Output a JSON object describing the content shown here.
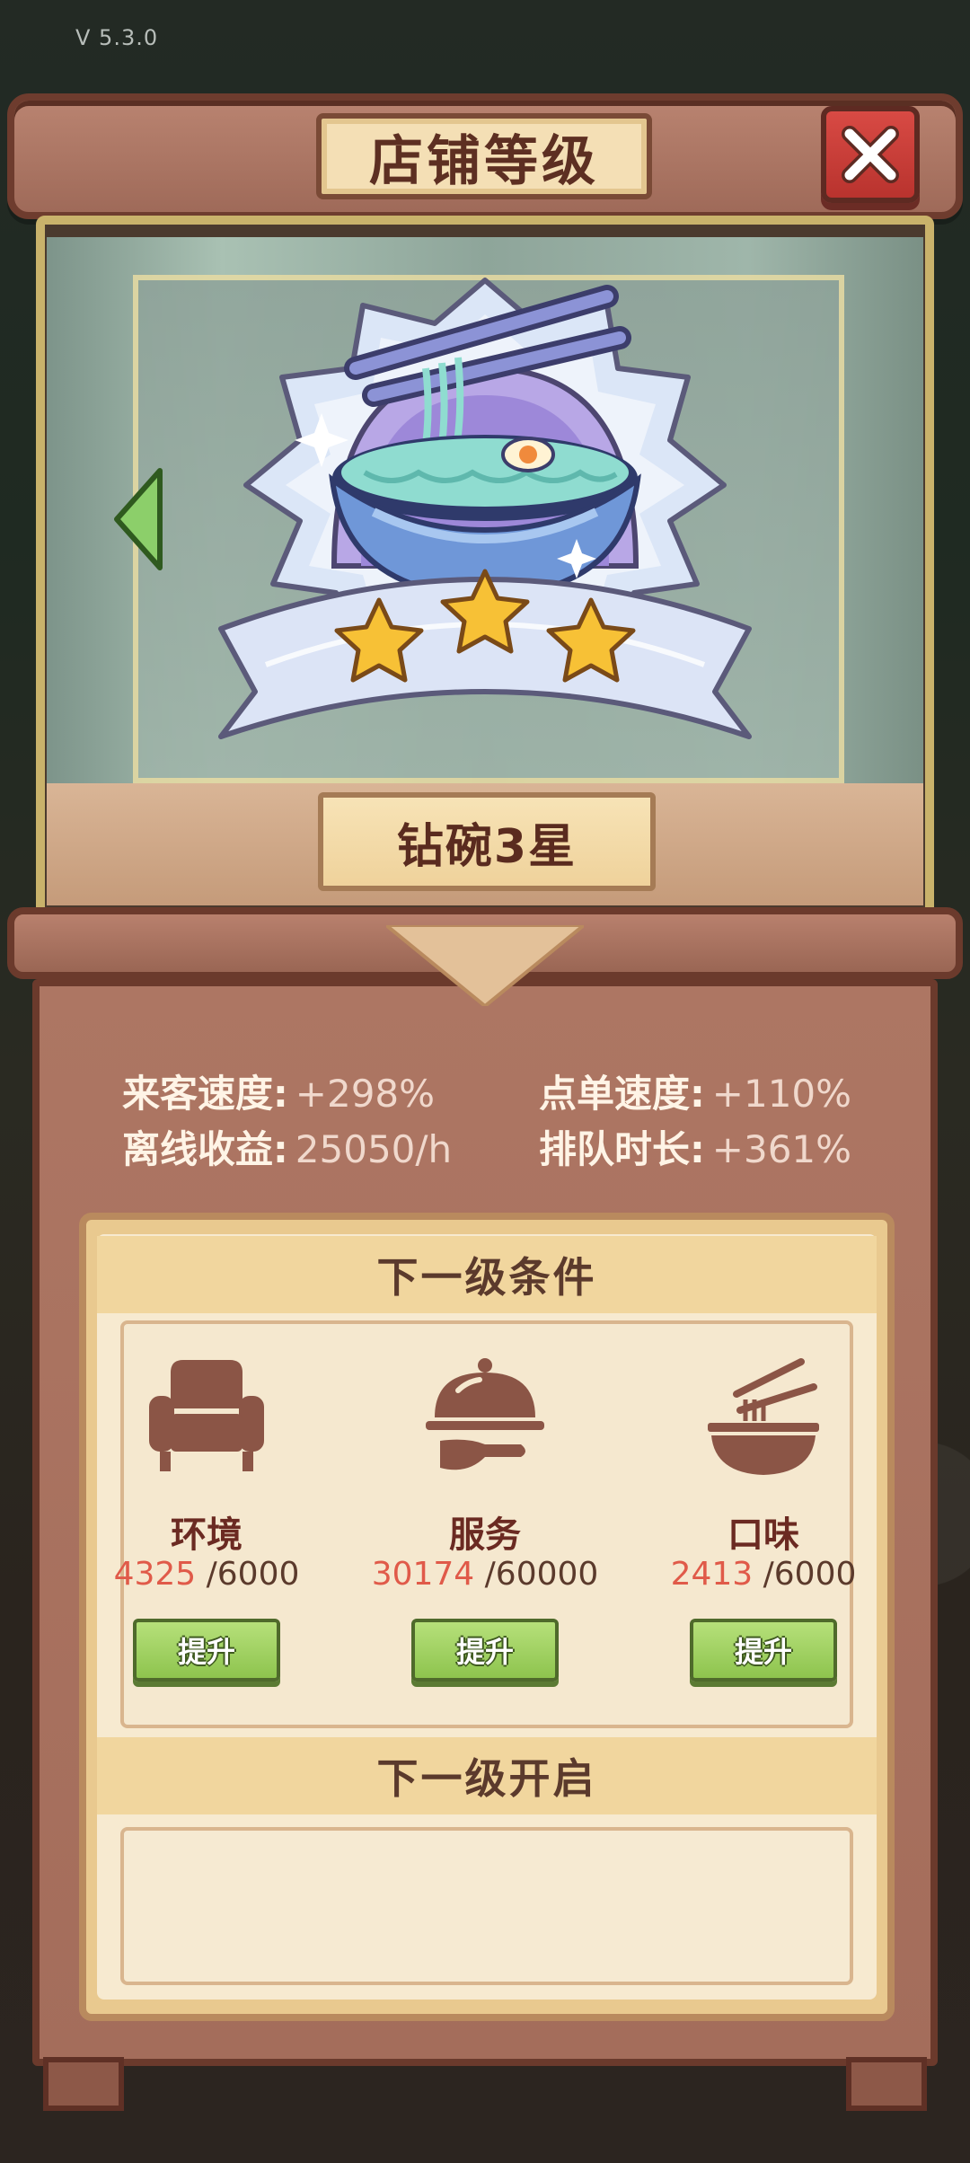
{
  "version": "V 5.3.0",
  "header": {
    "title": "店铺等级"
  },
  "display": {
    "level_name": "钻碗3星",
    "stars": 3
  },
  "stats": [
    {
      "label": "来客速度:",
      "value": "+298%"
    },
    {
      "label": "点单速度:",
      "value": "+110%"
    },
    {
      "label": "离线收益:",
      "value": "25050/h"
    },
    {
      "label": "排队时长:",
      "value": "+361%"
    }
  ],
  "next_level_conditions": {
    "title": "下一级条件",
    "items": [
      {
        "name": "环境",
        "icon": "armchair-icon",
        "current": "4325",
        "target": " /6000",
        "button": "提升"
      },
      {
        "name": "服务",
        "icon": "serving-cloche-icon",
        "current": "30174",
        "target": " /60000",
        "button": "提升"
      },
      {
        "name": "口味",
        "icon": "noodle-bowl-icon",
        "current": "2413",
        "target": " /6000",
        "button": "提升"
      }
    ]
  },
  "next_level_unlock": {
    "title": "下一级开启"
  },
  "colors": {
    "accent_red": "#e05a49",
    "button_green": "#8ec44e",
    "wood": "#a46d5b"
  }
}
